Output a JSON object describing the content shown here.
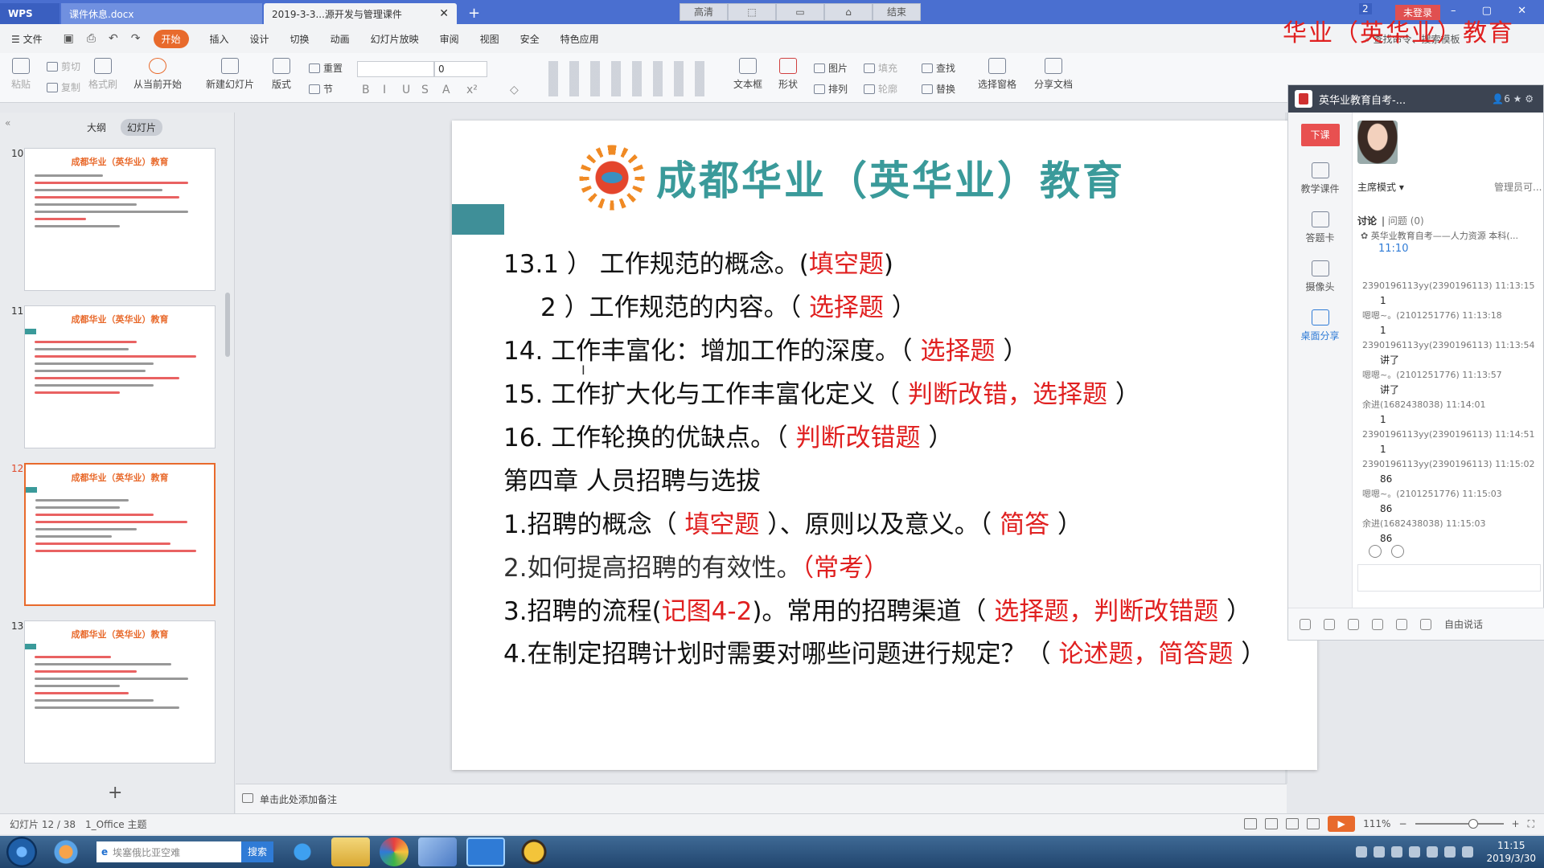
{
  "titlebar": {
    "wps_tab": "WPS",
    "doc_tab": "课件休息.docx",
    "active_tab": "2019-3-3...源开发与管理课件",
    "mid_buttons": [
      "高清",
      "",
      "",
      "",
      "结束"
    ],
    "login": "未登录",
    "count": "2"
  },
  "overlay_brand": "华业（英华业）教育",
  "menu": {
    "file": "文件",
    "items": [
      "开始",
      "插入",
      "设计",
      "切换",
      "动画",
      "幻灯片放映",
      "审阅",
      "视图",
      "安全",
      "特色应用"
    ],
    "search_cmd": "查找命令、搜索模板"
  },
  "ribbon": {
    "paste": "粘贴",
    "cut": "剪切",
    "copy": "复制",
    "format_painter": "格式刷",
    "from_current": "从当前开始",
    "new_slide": "新建幻灯片",
    "layout": "版式",
    "reset": "重置",
    "section": "节",
    "font_size": "0",
    "textbox": "文本框",
    "shape": "形状",
    "picture": "图片",
    "arrange": "排列",
    "fill": "填充",
    "outline": "轮廓",
    "find": "查找",
    "replace": "替换",
    "select_pane": "选择窗格",
    "share_doc": "分享文档"
  },
  "leftpanel": {
    "tab_outline": "大纲",
    "tab_slides": "幻灯片",
    "thumbs": [
      {
        "num": "10",
        "title": "成都华业（英华业）教育"
      },
      {
        "num": "11",
        "title": "成都华业（英华业）教育"
      },
      {
        "num": "12",
        "title": "成都华业（英华业）教育"
      },
      {
        "num": "13",
        "title": "成都华业（英华业）教育"
      }
    ]
  },
  "slide": {
    "brand": "成都华业（英华业）教育",
    "lines": [
      {
        "a": "13.1 ）  工作规范的概念。(",
        "r": "填空题",
        "b": ")"
      },
      {
        "a": "2 ）工作规范的内容。（ ",
        "r": "选择题",
        "b": " ）"
      },
      {
        "a": "14. 工作丰富化：增加工作的深度。（ ",
        "r": "选择题",
        "b": " ）"
      },
      {
        "a": "15. 工作扩大化与工作丰富化定义（ ",
        "r": "判断改错，选择题",
        "b": " ）"
      },
      {
        "a": "16. 工作轮换的优缺点。（ ",
        "r": "判断改错题",
        "b": " ）"
      },
      {
        "a": "第四章 人员招聘与选拔",
        "r": "",
        "b": ""
      },
      {
        "a": "1.招聘的概念（ ",
        "r": "填空题",
        "b": " ）、原则以及意义。（ ",
        "r2": "简答",
        "c": " ）"
      },
      {
        "a": "2.如何提高招聘的有效性。",
        "r": "（常考）",
        "b": ""
      },
      {
        "a": "3.招聘的流程(",
        "r": "记图4-2",
        "b": ")。常用的招聘渠道（ ",
        "r2": "选择题，判断改错题",
        "c": " ）"
      },
      {
        "a": "4.在制定招聘计划时需要对哪些问题进行规定？（ ",
        "r": "论述题，简答题",
        "b": " ）"
      }
    ]
  },
  "notes": "单击此处添加备注",
  "statusbar": {
    "slide_info": "幻灯片 12 / 38",
    "theme": "1_Office 主题",
    "zoom": "111%"
  },
  "classpanel": {
    "title": "英华业教育自考-...",
    "member_count": "6",
    "end_class": "下课",
    "tools": [
      "教学课件",
      "答题卡",
      "摄像头",
      "桌面分享"
    ],
    "mode": "主席模式",
    "admin": "管理员可...",
    "tab_discuss": "讨论",
    "tab_question": "问题 (0)",
    "notice": "英华业教育自考——人力资源 本科(...",
    "notice_time": "11:10",
    "messages": [
      {
        "who": "2390196113yy(2390196113) 11:13:15",
        "text": "1"
      },
      {
        "who": "嗯嗯~。(2101251776) 11:13:18",
        "text": "1"
      },
      {
        "who": "2390196113yy(2390196113) 11:13:54",
        "text": "讲了"
      },
      {
        "who": "嗯嗯~。(2101251776) 11:13:57",
        "text": "讲了"
      },
      {
        "who": "余进(1682438038) 11:14:01",
        "text": "1"
      },
      {
        "who": "2390196113yy(2390196113) 11:14:51",
        "text": "1"
      },
      {
        "who": "2390196113yy(2390196113) 11:15:02",
        "text": "86"
      },
      {
        "who": "嗯嗯~。(2101251776) 11:15:03",
        "text": "86"
      },
      {
        "who": "余进(1682438038) 11:15:03",
        "text": "86"
      }
    ],
    "free_talk": "自由说话"
  },
  "taskbar": {
    "search_placeholder": "埃塞俄比亚空难",
    "search_btn": "搜索",
    "time": "11:15",
    "date": "2019/3/30"
  },
  "colors": {
    "accent": "#e86a2c",
    "brand_teal": "#3a9a9a",
    "exam_red": "#e02020"
  }
}
